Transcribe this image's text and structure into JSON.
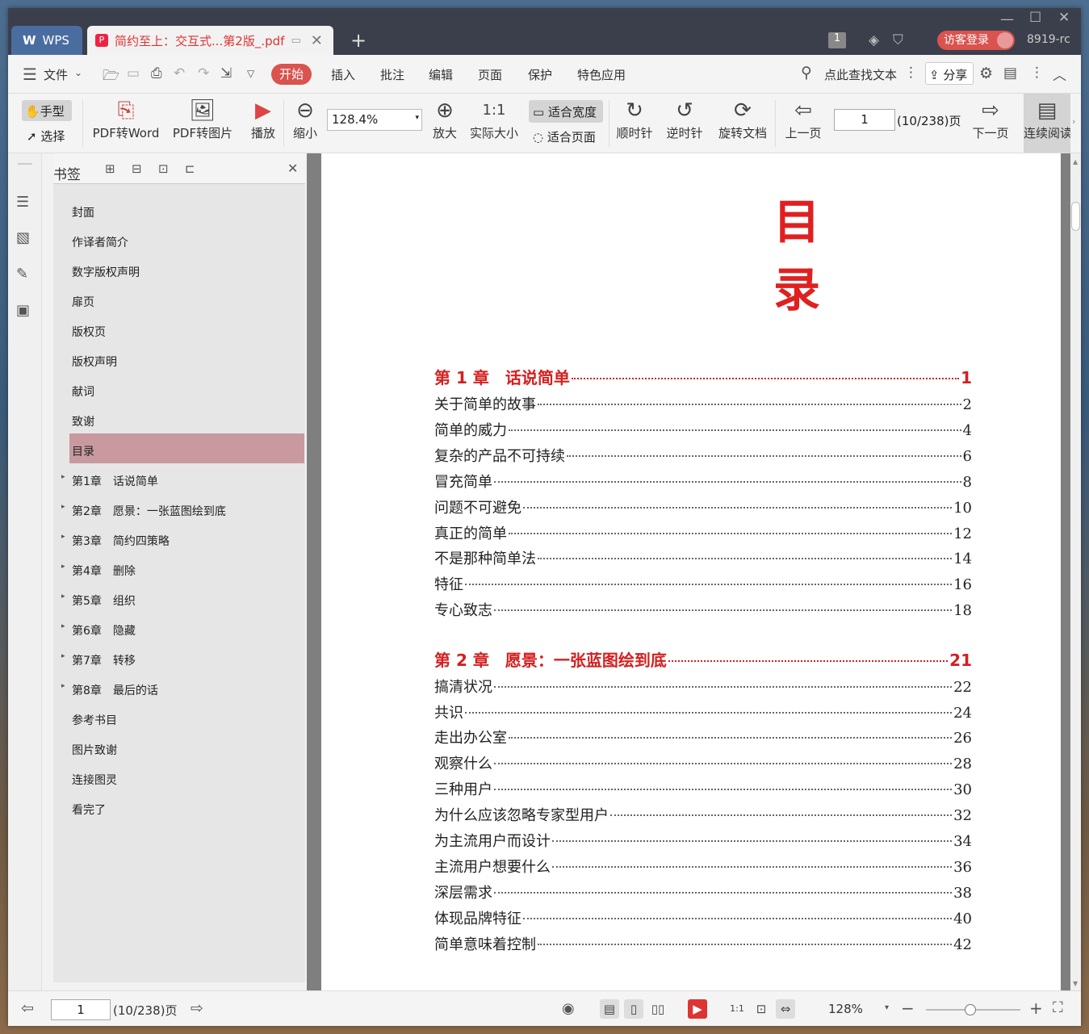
{
  "app": {
    "name": "WPS",
    "doc_tab": "简约至上：交互式...第2版_.pdf",
    "badge": "1",
    "login": "访客登录",
    "user": "8919-rc"
  },
  "menu": {
    "file": "文件",
    "items": [
      "开始",
      "插入",
      "批注",
      "编辑",
      "页面",
      "保护",
      "特色应用"
    ],
    "search": "点此查找文本",
    "share": "分享"
  },
  "toolbar": {
    "hand": "手型",
    "select": "选择",
    "pdf2word": "PDF转Word",
    "pdf2img": "PDF转图片",
    "play": "播放",
    "zoom_out": "缩小",
    "zoom_value": "128.4%",
    "zoom_in": "放大",
    "actual": "实际大小",
    "fit_width": "适合宽度",
    "fit_page": "适合页面",
    "cw": "顺时针",
    "ccw": "逆时针",
    "rotate_doc": "旋转文档",
    "prev": "上一页",
    "page": "1",
    "page_total": "(10/238)页",
    "next": "下一页",
    "continuous": "连续阅读"
  },
  "bookmarks": {
    "title": "书签",
    "items": [
      {
        "label": "封面",
        "expand": false
      },
      {
        "label": "作译者简介",
        "expand": false
      },
      {
        "label": "数字版权声明",
        "expand": false
      },
      {
        "label": "扉页",
        "expand": false
      },
      {
        "label": "版权页",
        "expand": false
      },
      {
        "label": "版权声明",
        "expand": false
      },
      {
        "label": "献词",
        "expand": false
      },
      {
        "label": "致谢",
        "expand": false
      },
      {
        "label": "目录",
        "expand": false,
        "selected": true
      },
      {
        "label": "第1章　话说简单",
        "expand": true
      },
      {
        "label": "第2章　愿景：一张蓝图绘到底",
        "expand": true
      },
      {
        "label": "第3章　简约四策略",
        "expand": true
      },
      {
        "label": "第4章　删除",
        "expand": true
      },
      {
        "label": "第5章　组织",
        "expand": true
      },
      {
        "label": "第6章　隐藏",
        "expand": true
      },
      {
        "label": "第7章　转移",
        "expand": true
      },
      {
        "label": "第8章　最后的话",
        "expand": true
      },
      {
        "label": "参考书目",
        "expand": false
      },
      {
        "label": "图片致谢",
        "expand": false
      },
      {
        "label": "连接图灵",
        "expand": false
      },
      {
        "label": "看完了",
        "expand": false
      }
    ]
  },
  "document": {
    "title": "目录",
    "toc": [
      {
        "text": "第 1 章　话说简单",
        "page": "1",
        "chapter": true
      },
      {
        "text": "关于简单的故事",
        "page": "2"
      },
      {
        "text": "简单的威力",
        "page": "4"
      },
      {
        "text": "复杂的产品不可持续",
        "page": "6"
      },
      {
        "text": "冒充简单",
        "page": "8"
      },
      {
        "text": "问题不可避免",
        "page": "10"
      },
      {
        "text": "真正的简单",
        "page": "12"
      },
      {
        "text": "不是那种简单法",
        "page": "14"
      },
      {
        "text": "特征",
        "page": "16"
      },
      {
        "text": "专心致志",
        "page": "18"
      },
      {
        "text": "第 2 章　愿景：一张蓝图绘到底",
        "page": "21",
        "chapter": true
      },
      {
        "text": "搞清状况",
        "page": "22"
      },
      {
        "text": "共识",
        "page": "24"
      },
      {
        "text": "走出办公室",
        "page": "26"
      },
      {
        "text": "观察什么",
        "page": "28"
      },
      {
        "text": "三种用户",
        "page": "30"
      },
      {
        "text": "为什么应该忽略专家型用户",
        "page": "32"
      },
      {
        "text": "为主流用户而设计",
        "page": "34"
      },
      {
        "text": "主流用户想要什么",
        "page": "36"
      },
      {
        "text": "深层需求",
        "page": "38"
      },
      {
        "text": "体现品牌特征",
        "page": "40"
      },
      {
        "text": "简单意味着控制",
        "page": "42"
      }
    ]
  },
  "status": {
    "page": "1",
    "page_total": "(10/238)页",
    "zoom": "128%"
  },
  "colors": {
    "accent": "#d9534f",
    "toc_red": "#d42020"
  }
}
